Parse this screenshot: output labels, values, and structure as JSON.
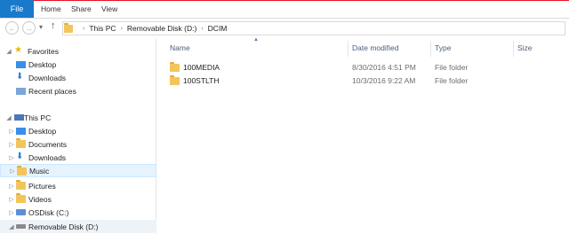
{
  "ribbon": {
    "file_tab": "File",
    "tabs": [
      "Home",
      "Share",
      "View"
    ]
  },
  "navigation": {
    "back_glyph": "←",
    "forward_glyph": "→",
    "recent_glyph": "▾",
    "up_glyph": "↑",
    "breadcrumb": [
      "This PC",
      "Removable Disk (D:)",
      "DCIM"
    ],
    "separator": "›"
  },
  "nav_pane": {
    "favorites": {
      "label": "Favorites",
      "items": [
        {
          "label": "Desktop",
          "icon": "desktop-icon"
        },
        {
          "label": "Downloads",
          "icon": "downloads-icon"
        },
        {
          "label": "Recent places",
          "icon": "recent-places-icon"
        }
      ]
    },
    "this_pc": {
      "label": "This PC",
      "items": [
        {
          "label": "Desktop",
          "icon": "desktop-icon"
        },
        {
          "label": "Documents",
          "icon": "documents-icon"
        },
        {
          "label": "Downloads",
          "icon": "downloads-icon"
        },
        {
          "label": "Music",
          "icon": "music-icon",
          "selected": true
        },
        {
          "label": "Pictures",
          "icon": "pictures-icon"
        },
        {
          "label": "Videos",
          "icon": "videos-icon"
        },
        {
          "label": "OSDisk (C:)",
          "icon": "os-disk-icon"
        },
        {
          "label": "Removable Disk (D:)",
          "icon": "removable-disk-icon"
        }
      ]
    }
  },
  "file_list": {
    "columns": [
      "Name",
      "Date modified",
      "Type",
      "Size"
    ],
    "rows": [
      {
        "name": "100MEDIA",
        "date": "8/30/2016 4:51 PM",
        "type": "File folder",
        "size": ""
      },
      {
        "name": "100STLTH",
        "date": "10/3/2016 9:22 AM",
        "type": "File folder",
        "size": ""
      }
    ]
  },
  "colors": {
    "accent": "#1979ca",
    "folder": "#f2c55c",
    "selection": "#e5f3ff",
    "header_text": "#4c607a"
  }
}
